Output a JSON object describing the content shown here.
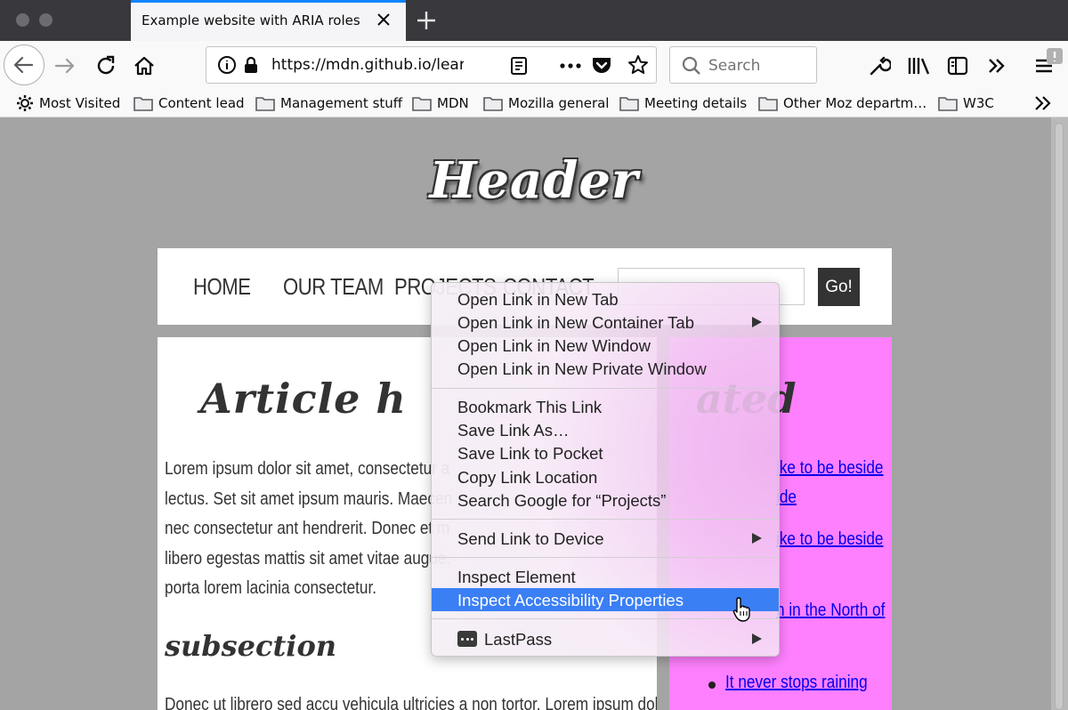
{
  "browser": {
    "tab_title": "Example website with ARIA roles",
    "url": "https://mdn.github.io/learning-area",
    "search_placeholder": "Search"
  },
  "bookmarks": [
    {
      "label": "Most Visited",
      "icon": "gear-icon"
    },
    {
      "label": "Content lead",
      "icon": "folder-icon"
    },
    {
      "label": "Management stuff",
      "icon": "folder-icon"
    },
    {
      "label": "MDN",
      "icon": "folder-icon"
    },
    {
      "label": "Mozilla general",
      "icon": "folder-icon"
    },
    {
      "label": "Meeting details",
      "icon": "folder-icon"
    },
    {
      "label": "Other Moz departm…",
      "icon": "folder-icon"
    },
    {
      "label": "W3C",
      "icon": "folder-icon"
    }
  ],
  "page": {
    "header": "Header",
    "nav": [
      "HOME",
      "OUR TEAM",
      "PROJECTS",
      "CONTACT"
    ],
    "search_button": "Go!",
    "article_heading": "Article h",
    "article_lines": [
      "Lorem ipsum dolor sit amet, consectetur a",
      "lectus. Set sit amet ipsum mauris. Maecen",
      "nec consectetur ant hendrerit. Donec et m",
      "libero egestas mattis sit amet vitae augue.",
      "porta lorem lacinia consectetur."
    ],
    "subsection": "subsection",
    "article_line_bottom": "Donec ut librero sed accu vehicula ultricies a non tortor. Lorem ipsum dolor",
    "aside_heading": "ated",
    "aside_links": [
      "ike to be beside",
      "ide",
      "ike to be beside",
      "n in the North of",
      "It never stops raining"
    ]
  },
  "context_menu": {
    "items": [
      {
        "label": "Open Link in New Tab",
        "submenu": false
      },
      {
        "label": "Open Link in New Container Tab",
        "submenu": true
      },
      {
        "label": "Open Link in New Window",
        "submenu": false
      },
      {
        "label": "Open Link in New Private Window",
        "submenu": false
      },
      {
        "label": "Bookmark This Link",
        "submenu": false
      },
      {
        "label": "Save Link As…",
        "submenu": false
      },
      {
        "label": "Save Link to Pocket",
        "submenu": false
      },
      {
        "label": "Copy Link Location",
        "submenu": false
      },
      {
        "label": "Search Google for “Projects”",
        "submenu": false
      },
      {
        "label": "Send Link to Device",
        "submenu": true
      },
      {
        "label": "Inspect Element",
        "submenu": false
      },
      {
        "label": "Inspect Accessibility Properties",
        "submenu": false,
        "highlighted": true
      },
      {
        "label": "LastPass",
        "submenu": true
      }
    ]
  },
  "colors": {
    "tab_accent": "#0a84ff",
    "menu_highlight": "#3b7ff5",
    "aside_background": "#ff80ff",
    "link": "#0000ee"
  }
}
